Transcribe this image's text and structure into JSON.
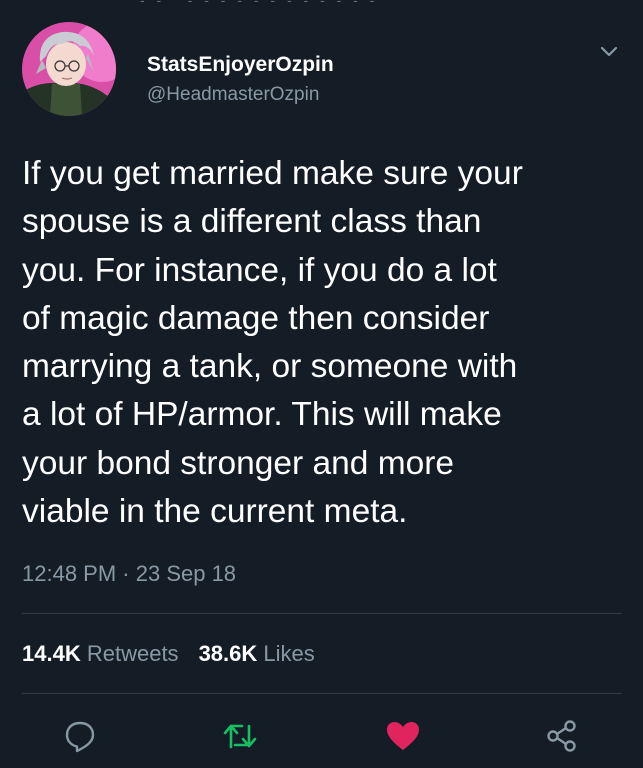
{
  "tweet": {
    "display_name": "StatsEnjoyerOzpin",
    "handle": "@HeadmasterOzpin",
    "text": "If you get married make sure your\nspouse is a different class than\nyou. For instance, if you do a lot\nof magic damage then consider\nmarrying a tank, or someone with\na lot of HP/armor. This will make\nyour bond stronger and more\nviable in the current meta.",
    "time": "12:48 PM",
    "separator": " · ",
    "date": "23 Sep 18"
  },
  "stats": {
    "retweets_count": "14.4K",
    "retweets_label": "Retweets",
    "likes_count": "38.6K",
    "likes_label": "Likes"
  },
  "icons": {
    "reply": "reply-icon",
    "retweet": "retweet-icon",
    "like": "heart-icon",
    "share": "share-icon",
    "menu": "chevron-down-icon"
  },
  "colors": {
    "background": "#141d26",
    "secondary_text": "#8899a6",
    "divider": "#2f3b47",
    "retweet_green": "#17bf63",
    "like_red": "#e0245e"
  }
}
